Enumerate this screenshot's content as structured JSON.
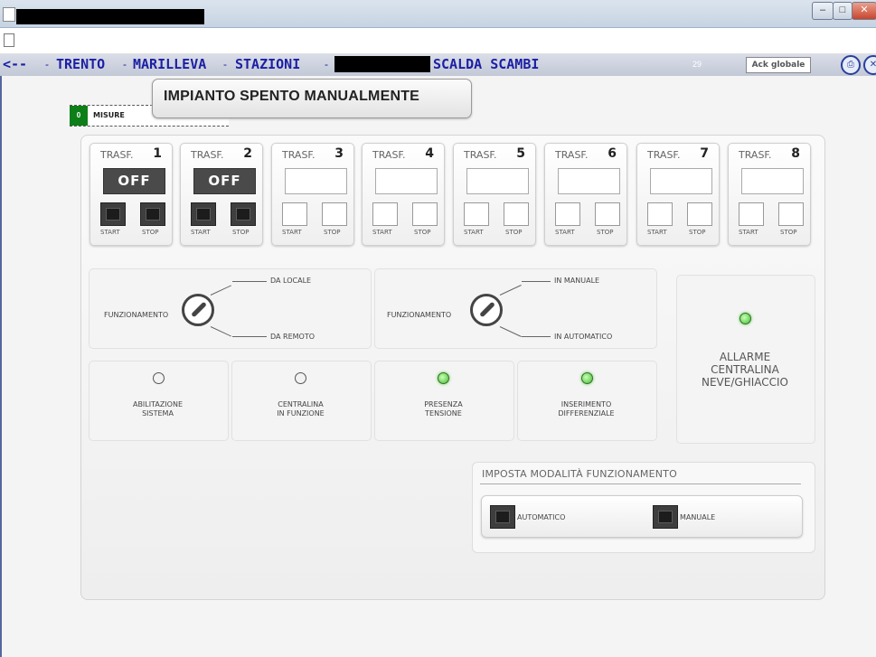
{
  "window": {
    "buttons": [
      "–",
      "□",
      "✕"
    ]
  },
  "nav": {
    "back": "<--",
    "sep": "-",
    "site": "TRENTO",
    "place": "MARILLEVA",
    "section": "STAZIONI",
    "device": "SCALDA SCAMBI",
    "count": "29",
    "ack_label": "Ack globale"
  },
  "misure": {
    "count": "0",
    "label": "MISURE"
  },
  "banner": {
    "text": "IMPIANTO SPENTO MANUALMENTE"
  },
  "trasf": {
    "label": "TRASF.",
    "start": "START",
    "stop": "STOP",
    "units": [
      {
        "num": "1",
        "status": "OFF"
      },
      {
        "num": "2",
        "status": "OFF"
      },
      {
        "num": "3",
        "status": ""
      },
      {
        "num": "4",
        "status": ""
      },
      {
        "num": "5",
        "status": ""
      },
      {
        "num": "6",
        "status": ""
      },
      {
        "num": "7",
        "status": ""
      },
      {
        "num": "8",
        "status": ""
      }
    ]
  },
  "funz": {
    "label": "FUNZIONAMENTO",
    "left": {
      "opt1": "DA LOCALE",
      "opt2": "DA REMOTO"
    },
    "right": {
      "opt1": "IN MANUALE",
      "opt2": "IN AUTOMATICO"
    }
  },
  "status": {
    "abilitazione": {
      "line1": "ABILITAZIONE",
      "line2": "SISTEMA",
      "led": "off"
    },
    "centralina": {
      "line1": "CENTRALINA",
      "line2": "IN FUNZIONE",
      "led": "off"
    },
    "presenza": {
      "line1": "PRESENZA",
      "line2": "TENSIONE",
      "led": "green"
    },
    "inserimento": {
      "line1": "INSERIMENTO",
      "line2": "DIFFERENZIALE",
      "led": "green"
    }
  },
  "alarm": {
    "line1": "ALLARME",
    "line2": "CENTRALINA",
    "line3": "NEVE/GHIACCIO",
    "led": "green"
  },
  "mode": {
    "title": "IMPOSTA MODALITÀ FUNZIONAMENTO",
    "auto": "AUTOMATICO",
    "manual": "MANUALE"
  },
  "colors": {
    "nav_text": "#1b1fa3",
    "misure_green": "#0d7f18",
    "led_green": "#3fbf2c"
  }
}
